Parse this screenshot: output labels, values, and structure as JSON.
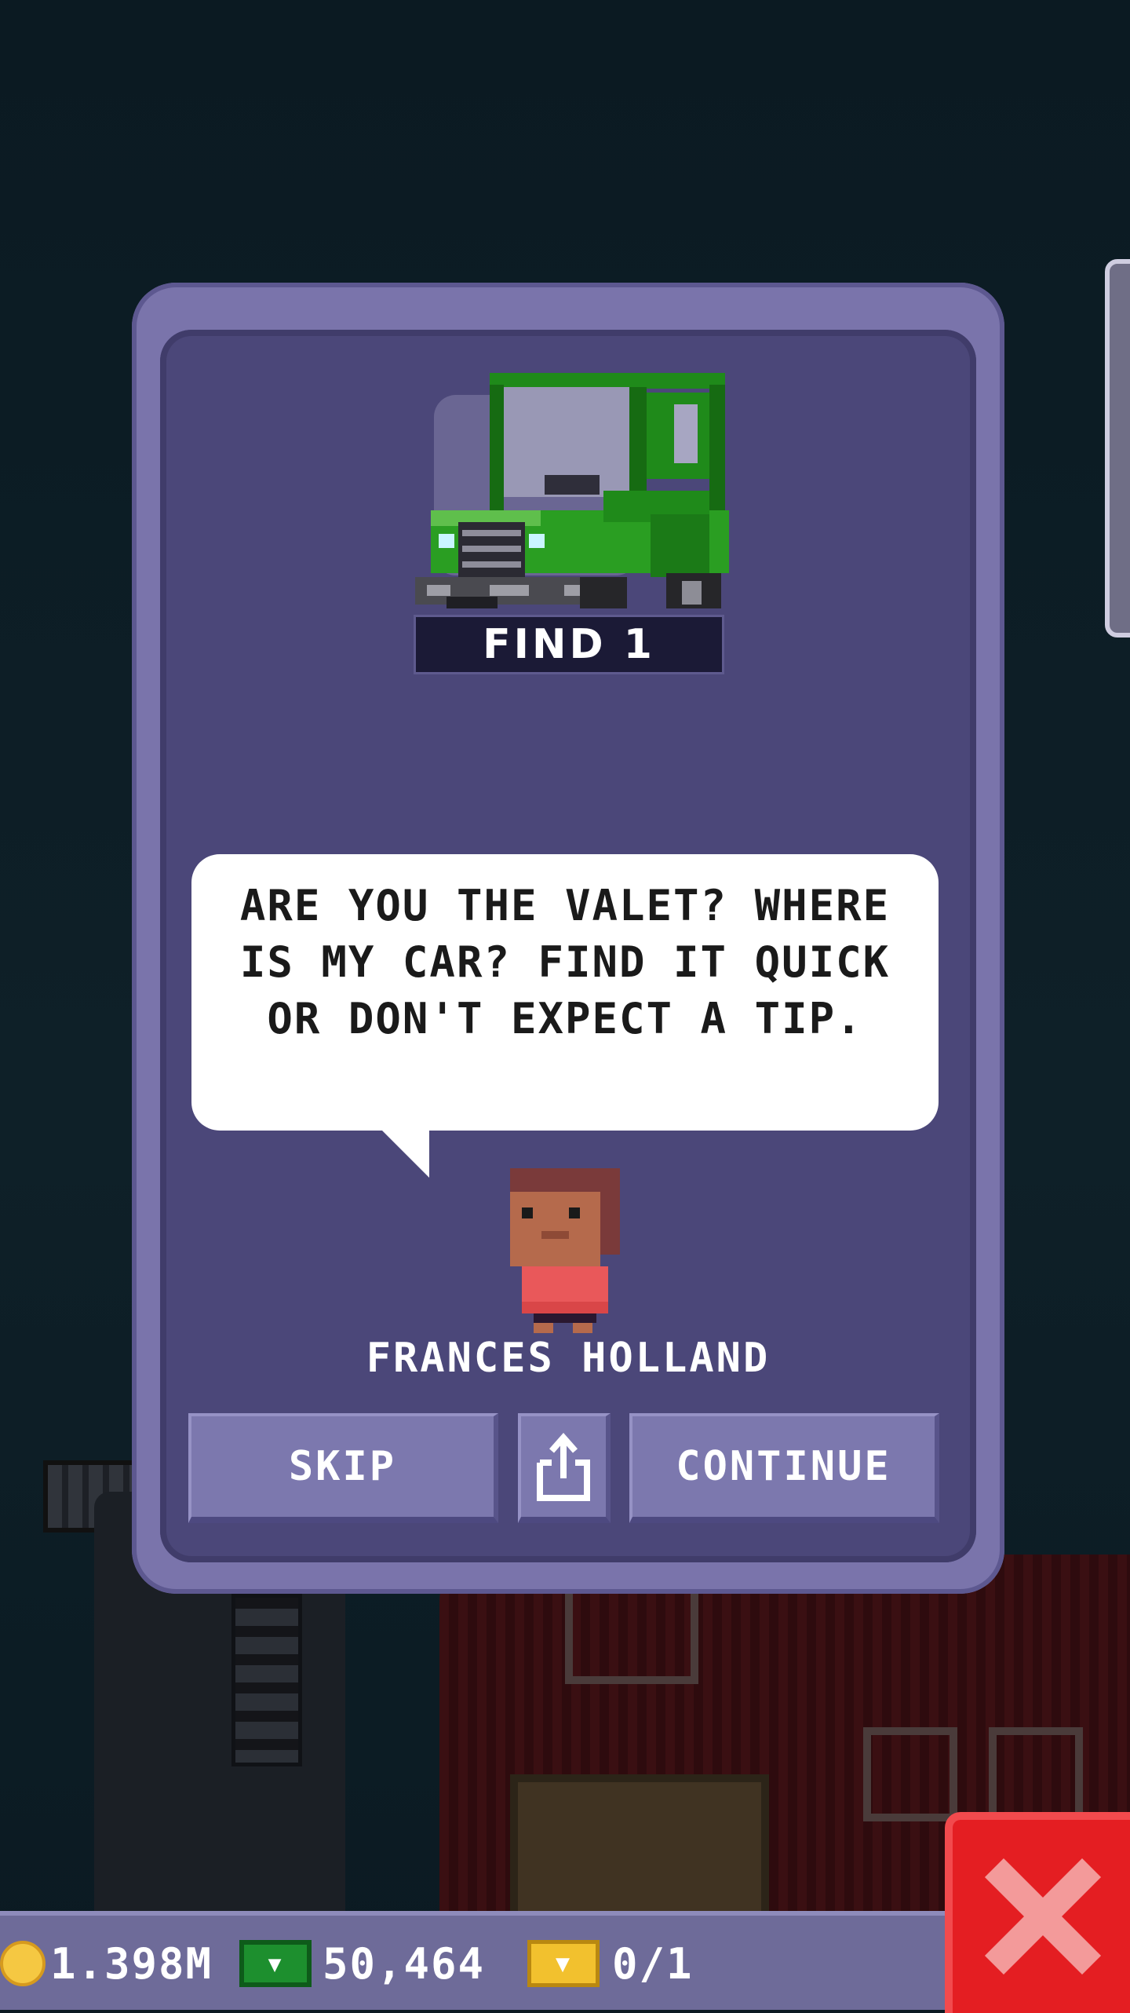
{
  "dialog": {
    "find_label": "FIND 1",
    "speech": "ARE YOU THE VALET? WHERE IS MY CAR? FIND IT QUICK OR DON'T EXPECT A TIP.",
    "character_name": "FRANCES HOLLAND",
    "buttons": {
      "skip": "SKIP",
      "continue": "CONTINUE"
    },
    "icons": {
      "car": "green-jeep-icon",
      "character": "frances-holland-avatar",
      "share": "share-icon"
    }
  },
  "bottom_bar": {
    "coins": "1.398M",
    "cash": "50,464",
    "tickets": "0/1",
    "icons": {
      "coins": "coin-icon",
      "cash": "cash-icon",
      "tickets": "ticket-icon"
    }
  },
  "close_button": {
    "icon": "close-icon"
  },
  "colors": {
    "background": "#0b1a22",
    "dialog": "#7a74ab",
    "dialog_inner": "#4b4779",
    "button": "#7c78ae",
    "close": "#e41e22",
    "car_green": "#1f8a1a"
  }
}
